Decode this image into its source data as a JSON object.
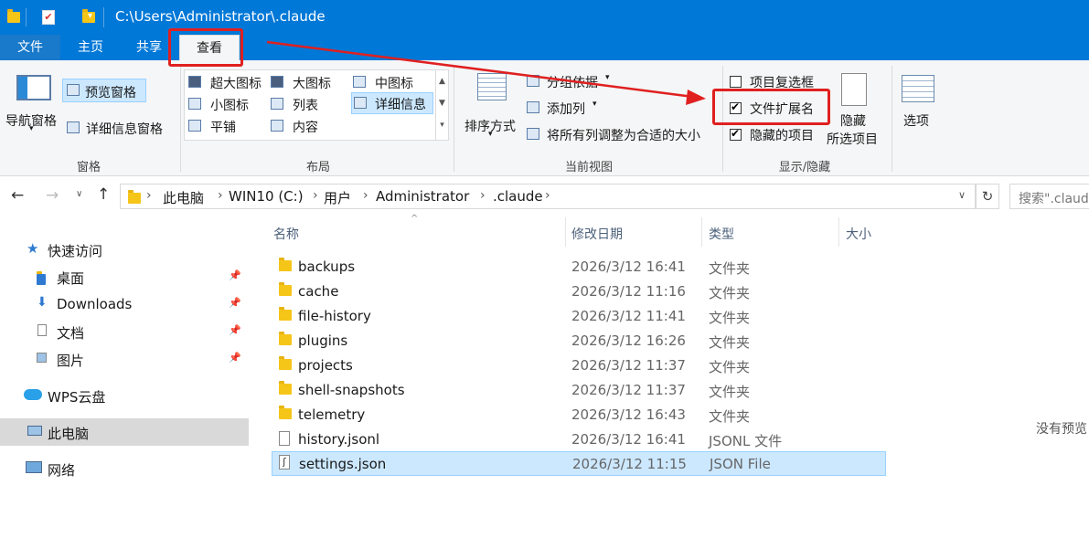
{
  "window": {
    "title": "C:\\Users\\Administrator\\.claude"
  },
  "tabs": [
    {
      "label": "文件"
    },
    {
      "label": "主页"
    },
    {
      "label": "共享"
    },
    {
      "label": "查看"
    }
  ],
  "ribbon": {
    "panes": {
      "nav_pane": "导航窗格",
      "preview_pane": "预览窗格",
      "details_pane": "详细信息窗格",
      "group_label": "窗格"
    },
    "layout": {
      "items": [
        "超大图标",
        "大图标",
        "中图标",
        "小图标",
        "列表",
        "详细信息",
        "平铺",
        "内容"
      ],
      "group_label": "布局"
    },
    "current_view": {
      "sort_by": "排序方式",
      "group_by": "分组依据",
      "add_column": "添加列",
      "fit_columns": "将所有列调整为合适的大小",
      "group_label": "当前视图"
    },
    "show_hide": {
      "item_checkboxes": {
        "label": "项目复选框",
        "checked": false
      },
      "file_extensions": {
        "label": "文件扩展名",
        "checked": true
      },
      "hidden_items": {
        "label": "隐藏的项目",
        "checked": true
      },
      "hide_selected_1": "隐藏",
      "hide_selected_2": "所选项目",
      "group_label": "显示/隐藏"
    },
    "options": "选项"
  },
  "address": {
    "crumbs": [
      "此电脑",
      "WIN10 (C:)",
      "用户",
      "Administrator",
      ".claude"
    ],
    "search_placeholder": "搜索\".claude\""
  },
  "nav": {
    "quick_access": "快速访问",
    "items": [
      {
        "label": "桌面",
        "pinned": true
      },
      {
        "label": "Downloads",
        "pinned": true
      },
      {
        "label": "文档",
        "pinned": true
      },
      {
        "label": "图片",
        "pinned": true
      }
    ],
    "wps": "WPS云盘",
    "this_pc": "此电脑",
    "network": "网络"
  },
  "columns": {
    "name": "名称",
    "modified": "修改日期",
    "type": "类型",
    "size": "大小"
  },
  "files": [
    {
      "name": "backups",
      "modified": "2026/3/12 16:41",
      "type": "文件夹",
      "kind": "folder"
    },
    {
      "name": "cache",
      "modified": "2026/3/12 11:16",
      "type": "文件夹",
      "kind": "folder"
    },
    {
      "name": "file-history",
      "modified": "2026/3/12 11:41",
      "type": "文件夹",
      "kind": "folder"
    },
    {
      "name": "plugins",
      "modified": "2026/3/12 16:26",
      "type": "文件夹",
      "kind": "folder"
    },
    {
      "name": "projects",
      "modified": "2026/3/12 11:37",
      "type": "文件夹",
      "kind": "folder"
    },
    {
      "name": "shell-snapshots",
      "modified": "2026/3/12 11:37",
      "type": "文件夹",
      "kind": "folder"
    },
    {
      "name": "telemetry",
      "modified": "2026/3/12 16:43",
      "type": "文件夹",
      "kind": "folder"
    },
    {
      "name": "history.jsonl",
      "modified": "2026/3/12 16:41",
      "type": "JSONL 文件",
      "kind": "file"
    },
    {
      "name": "settings.json",
      "modified": "2026/3/12 11:15",
      "type": "JSON File",
      "kind": "json",
      "selected": true
    }
  ],
  "preview": {
    "empty_text": "没有预览"
  },
  "colors": {
    "accent": "#0078d7",
    "annotation": "#e02020",
    "selection": "#cce8ff"
  }
}
